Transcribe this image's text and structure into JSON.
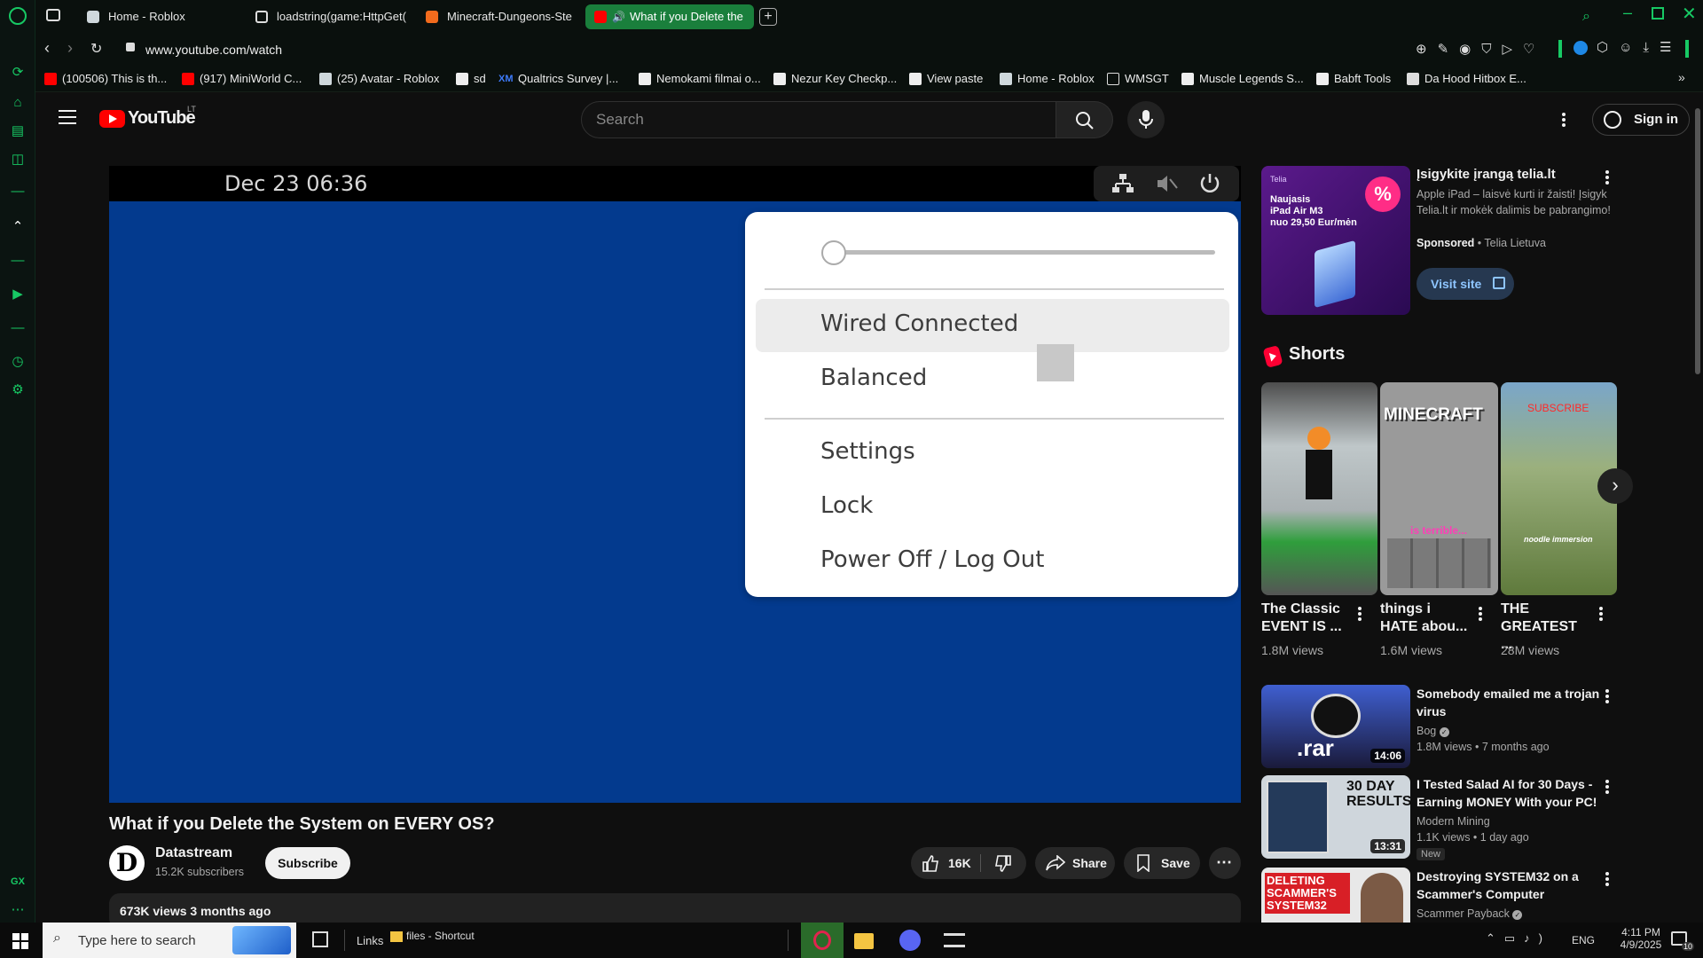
{
  "browser": {
    "tabs": [
      {
        "label": "Home - Roblox",
        "active": false
      },
      {
        "label": "loadstring(game:HttpGet(",
        "active": false
      },
      {
        "label": "Minecraft-Dungeons-Ste",
        "active": false
      },
      {
        "label": "What if you Delete the",
        "active": true
      }
    ],
    "url": "www.youtube.com/watch",
    "bookmarks": [
      "(100506) This is th...",
      "(917) MiniWorld C...",
      "(25) Avatar - Roblox",
      "sd",
      "Qualtrics Survey |...",
      "Nemokami filmai o...",
      "Nezur Key Checkp...",
      "View paste",
      "Home - Roblox",
      "WMSGT",
      "Muscle Legends S...",
      "Babft Tools",
      "Da Hood Hitbox E..."
    ],
    "bookmark_prefix_xm": "XM",
    "rail_gx": "GX",
    "accent": "#17c964"
  },
  "youtube": {
    "logo_text": "YouTube",
    "region": "LT",
    "search_placeholder": "Search",
    "sign_in": "Sign in",
    "video": {
      "osd_date": "Dec 23  06:36",
      "menu": {
        "slider_value": 0,
        "items": [
          "Wired Connected",
          "Balanced",
          "Settings",
          "Lock",
          "Power Off / Log Out"
        ]
      },
      "title": "What if you Delete the System on EVERY OS?",
      "channel": "Datastream",
      "channel_avatar_letter": "D",
      "subscribers": "15.2K subscribers",
      "subscribe": "Subscribe",
      "likes": "16K",
      "share": "Share",
      "save": "Save",
      "views_date": "673K views  3 months ago"
    },
    "ad": {
      "brand": "Telia",
      "image_text": "Naujasis\niPad Air M3\nnuo 29,50 Eur/mėn",
      "badge": "%",
      "title": "Įsigykite įrangą telia.lt",
      "body": "Apple iPad – laisvė kurti ir žaisti! Įsigyk Telia.lt ir mokėk dalimis be pabrangimo!",
      "sponsored": "Sponsored",
      "advertiser": "Telia Lietuva",
      "cta": "Visit site"
    },
    "shorts_header": "Shorts",
    "shorts": [
      {
        "title": "The Classic EVENT IS ...",
        "views": "1.8M views"
      },
      {
        "title": "things i HATE abou...",
        "views": "1.6M views",
        "overlay_top": "MINECRAFT",
        "overlay_bottom": "is terrible..."
      },
      {
        "title": "THE GREATEST ...",
        "views": "28M views",
        "overlay_top": "SUBSCRIBE",
        "overlay_bottom": "noodle immersion"
      }
    ],
    "recommended": [
      {
        "title": "Somebody emailed me a trojan virus",
        "channel": "Bog",
        "meta": "1.8M views • 7 months ago",
        "duration": "14:06",
        "thumb_text": ".rar",
        "badge": ""
      },
      {
        "title": "I Tested Salad AI for 30 Days - Earning MONEY With your PC!",
        "channel": "Modern Mining",
        "meta": "1.1K views • 1 day ago",
        "duration": "13:31",
        "thumb_text": "30 DAY RESULTS",
        "badge": "New"
      },
      {
        "title": "Destroying SYSTEM32 on a Scammer's Computer",
        "channel": "Scammer Payback",
        "meta": "",
        "duration": "",
        "thumb_text": "DELETING SCAMMER'S SYSTEM32",
        "badge": ""
      }
    ]
  },
  "taskbar": {
    "search_placeholder": "Type here to search",
    "links": "Links",
    "shortcut": "files - Shortcut",
    "lang": "ENG",
    "time": "4:11 PM",
    "date": "4/9/2025",
    "notifications": "10"
  }
}
